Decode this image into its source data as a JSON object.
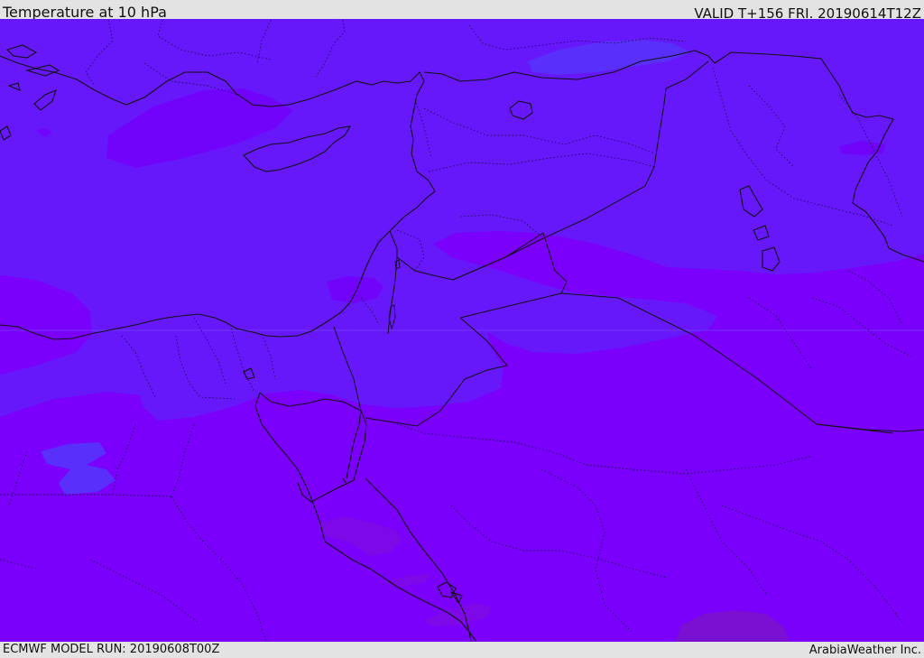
{
  "header": {
    "title": "Temperature at 10 hPa",
    "valid": "VALID T+156 FRI. 20190614T12Z"
  },
  "footer": {
    "model_run": "ECMWF MODEL RUN: 20190608T00Z",
    "credit": "ArabiaWeather Inc."
  },
  "colors": {
    "cool": "#6718fb",
    "base": "#7b00fb",
    "coldest": "#5930fb",
    "warm": "#7d08e8",
    "warmest": "#7a10d2",
    "border": "#111111"
  }
}
